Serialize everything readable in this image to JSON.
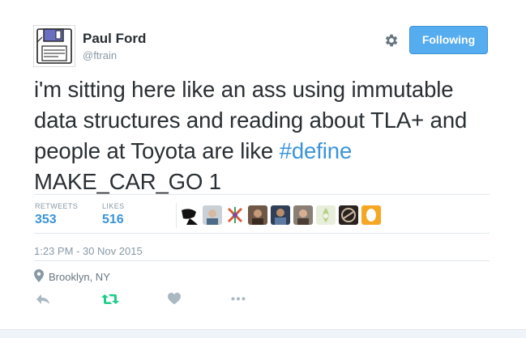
{
  "user": {
    "name": "Paul Ford",
    "handle": "@ftrain",
    "avatar_icon": "floppy-disk-icon"
  },
  "header": {
    "follow_label": "Following",
    "settings_icon": "gear-icon"
  },
  "tweet": {
    "text_before": "i'm sitting here like an ass using immutable data structures and reading about TLA+ and people at Toyota are like ",
    "hashtag": "#define",
    "text_after": " MAKE_CAR_GO 1"
  },
  "stats": {
    "retweets_label": "RETWEETS",
    "retweets_count": "353",
    "likes_label": "LIKES",
    "likes_count": "516"
  },
  "likers": [
    {
      "icon": "liker-avatar-1",
      "color": "#1a1a1a"
    },
    {
      "icon": "liker-avatar-2",
      "color": "#9aa6b0"
    },
    {
      "icon": "liker-avatar-3",
      "color": "#d85a3a"
    },
    {
      "icon": "liker-avatar-4",
      "color": "#8b6a4d"
    },
    {
      "icon": "liker-avatar-5",
      "color": "#4a5d7a"
    },
    {
      "icon": "liker-avatar-6",
      "color": "#7a6a58"
    },
    {
      "icon": "liker-avatar-7",
      "color": "#c7d8a8"
    },
    {
      "icon": "liker-avatar-8",
      "color": "#3a2e28"
    },
    {
      "icon": "liker-avatar-9",
      "color": "#f5a623"
    }
  ],
  "meta": {
    "timestamp": "1:23 PM - 30 Nov 2015",
    "location": "Brooklyn, NY"
  },
  "actions": {
    "reply_icon": "reply-icon",
    "retweet_icon": "retweet-icon",
    "like_icon": "heart-icon",
    "more_icon": "more-icon"
  },
  "colors": {
    "accent": "#55acee",
    "link": "#3b94d9",
    "retweet_green": "#19cf86",
    "muted": "#8899a6"
  }
}
